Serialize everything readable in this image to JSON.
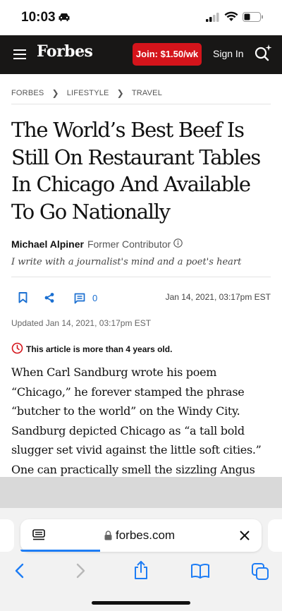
{
  "status_bar": {
    "time": "10:03"
  },
  "header": {
    "logo": "Forbes",
    "join_label": "Join: $1.50/wk",
    "signin_label": "Sign In"
  },
  "breadcrumb": [
    "FORBES",
    "LIFESTYLE",
    "TRAVEL"
  ],
  "article": {
    "headline_lines": [
      "The World’s Best Beef Is",
      "Still On Restaurant Tables",
      "In Chicago And Available",
      "To Go Nationally"
    ],
    "author": "Michael Alpiner",
    "author_role": "Former Contributor",
    "author_bio": "I write with a journalist's mind and a poet's heart",
    "comment_count": "0",
    "published": "Jan 14, 2021,  03:17pm EST",
    "updated": "Updated Jan 14, 2021, 03:17pm EST",
    "age_warning": "This article is more than 4 years old.",
    "body_lines": [
      "When Carl Sandburg wrote his poem",
      "“Chicago,” he forever stamped the phrase",
      "“butcher to the world” on the Windy City.",
      "Sandburg depicted Chicago as “a tall bold",
      "slugger set vivid against the little soft cities.”",
      "One can practically smell the sizzling Angus"
    ]
  },
  "browser": {
    "url": "forbes.com"
  },
  "colors": {
    "header_bg": "#181716",
    "join_button": "#d4141b",
    "accent_blue": "#1a6fd1",
    "warning_red": "#d4141b"
  },
  "icons": [
    "car-icon",
    "signal-icon",
    "wifi-icon",
    "battery-icon",
    "menu-icon",
    "search-ai-icon",
    "info-icon",
    "bookmark-icon",
    "share-icon",
    "comments-icon",
    "clock-icon",
    "tabs-overview-icon",
    "lock-icon",
    "close-icon",
    "back-icon",
    "forward-icon",
    "share-sheet-icon",
    "bookmarks-book-icon",
    "tabs-icon"
  ]
}
